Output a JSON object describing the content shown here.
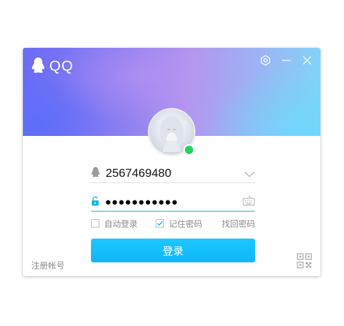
{
  "app": {
    "logo_text": "QQ"
  },
  "window_controls": {
    "settings_icon": "settings-icon",
    "minimize_icon": "minimize-icon",
    "close_icon": "close-icon"
  },
  "profile": {
    "status": "online",
    "status_color": "#22d35a"
  },
  "account": {
    "value": "2567469480",
    "icon": "qq-user-icon",
    "dropdown_icon": "chevron-down-icon"
  },
  "password": {
    "masked_value": "●●●●●●●●●●●",
    "icon": "lock-icon",
    "keyboard_icon": "keyboard-icon"
  },
  "options": {
    "auto_login_label": "自动登录",
    "auto_login_checked": false,
    "remember_password_label": "记住密码",
    "remember_password_checked": true,
    "forgot_password_label": "找回密码"
  },
  "login_button": {
    "label": "登录",
    "color": "#12bdf7"
  },
  "footer": {
    "register_label": "注册帐号",
    "qr_icon": "qr-code-icon"
  }
}
